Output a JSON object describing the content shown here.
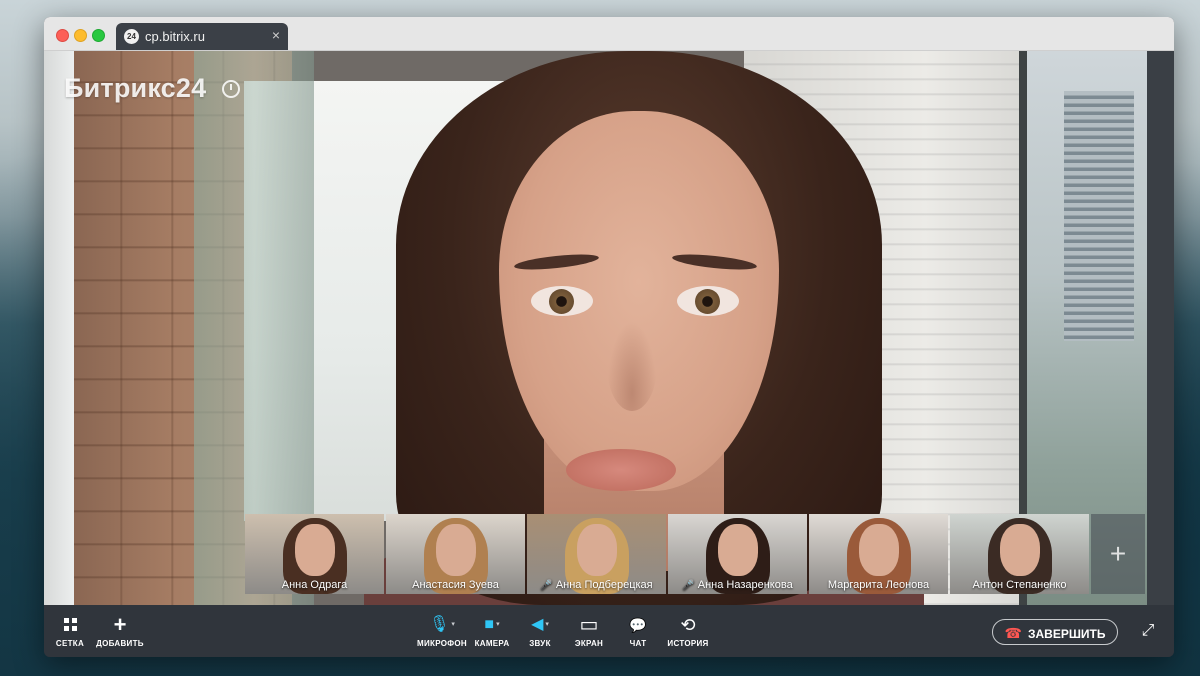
{
  "browser": {
    "tab_title": "cp.bitrix.ru",
    "tab_favicon": "24",
    "tab_close": "×"
  },
  "brand": {
    "name": "Битрикс24"
  },
  "participants": [
    {
      "name": "Анна Одрага",
      "mic_off": false,
      "bg": "#cdbfae",
      "hair": "#4a2f22"
    },
    {
      "name": "Анастасия Зуева",
      "mic_off": false,
      "bg": "#dcd5cc",
      "hair": "#b08050"
    },
    {
      "name": "Анна Подберецкая",
      "mic_off": true,
      "bg": "#a98f74",
      "hair": "#c9a060"
    },
    {
      "name": "Анна Назаренкова",
      "mic_off": true,
      "bg": "#d9d6d2",
      "hair": "#2e1d17"
    },
    {
      "name": "Маргарита Леонова",
      "mic_off": false,
      "bg": "#e0dbd5",
      "hair": "#9a5a3a"
    },
    {
      "name": "Антон Степаненко",
      "mic_off": false,
      "bg": "#cfd4d0",
      "hair": "#3b2b24"
    }
  ],
  "more_participants": "+",
  "icons": {
    "mic_off": "🎤",
    "grid": "grid-icon",
    "add": "+",
    "microphone": "🎙",
    "camera": "■",
    "sound": "◀",
    "screen": "▭",
    "chat": "💬",
    "history": "⟲",
    "end_call": "☎",
    "fullscreen": "⤢",
    "caret": "▾"
  },
  "toolbar": {
    "grid_label": "СЕТКА",
    "add_label": "ДОБАВИТЬ",
    "microphone_label": "МИКРОФОН",
    "camera_label": "КАМЕРА",
    "sound_label": "ЗВУК",
    "screen_label": "ЭКРАН",
    "chat_label": "ЧАТ",
    "history_label": "ИСТОРИЯ",
    "end_call_label": "ЗАВЕРШИТЬ"
  },
  "colors": {
    "accent": "#2fc6f6",
    "end_call_icon": "#ff5752",
    "toolbar_bg": "#30353c"
  }
}
